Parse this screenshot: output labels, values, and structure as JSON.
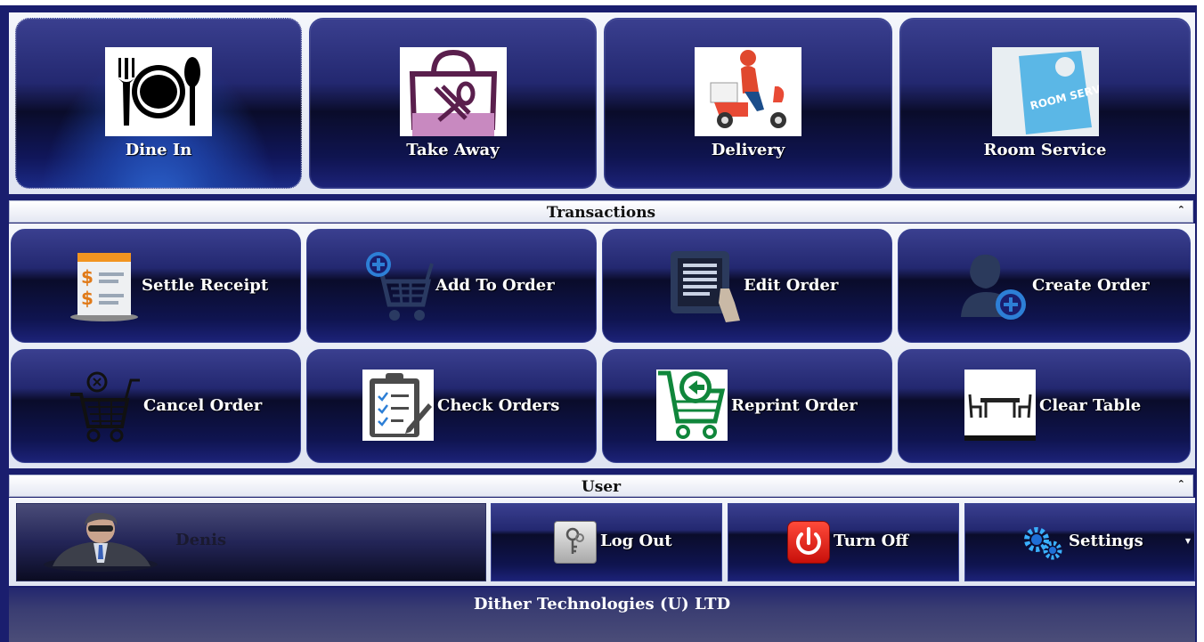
{
  "order_types": [
    {
      "label": "Dine In",
      "icon": "dine-in-plate-icon"
    },
    {
      "label": "Take Away",
      "icon": "takeaway-bag-icon"
    },
    {
      "label": "Delivery",
      "icon": "delivery-scooter-icon"
    },
    {
      "label": "Room Service",
      "icon": "room-service-doorhanger-icon"
    }
  ],
  "room_service_sign": "ROOM SERVICE",
  "transactions": {
    "title": "Transactions",
    "items": [
      {
        "label": "Settle Receipt",
        "icon": "receipt-icon"
      },
      {
        "label": "Add To Order",
        "icon": "cart-add-icon"
      },
      {
        "label": "Edit Order",
        "icon": "tablet-edit-icon"
      },
      {
        "label": "Create Order",
        "icon": "user-add-icon"
      },
      {
        "label": "Cancel Order",
        "icon": "cart-cancel-icon"
      },
      {
        "label": "Check Orders",
        "icon": "clipboard-checklist-icon"
      },
      {
        "label": "Reprint Order",
        "icon": "cart-back-icon"
      },
      {
        "label": "Clear Table",
        "icon": "table-icon"
      }
    ]
  },
  "user": {
    "title": "User",
    "name": "Denis",
    "log_out": "Log Out",
    "turn_off": "Turn Off",
    "settings": "Settings"
  },
  "footer": "Dither Technologies (U) LTD",
  "colors": {
    "frame": "#1a1e6e",
    "tile_dark": "#0a0c2a",
    "tile_light": "#3a3f8f",
    "text": "#ffffff",
    "selected_glow": "#2f6ad6"
  }
}
